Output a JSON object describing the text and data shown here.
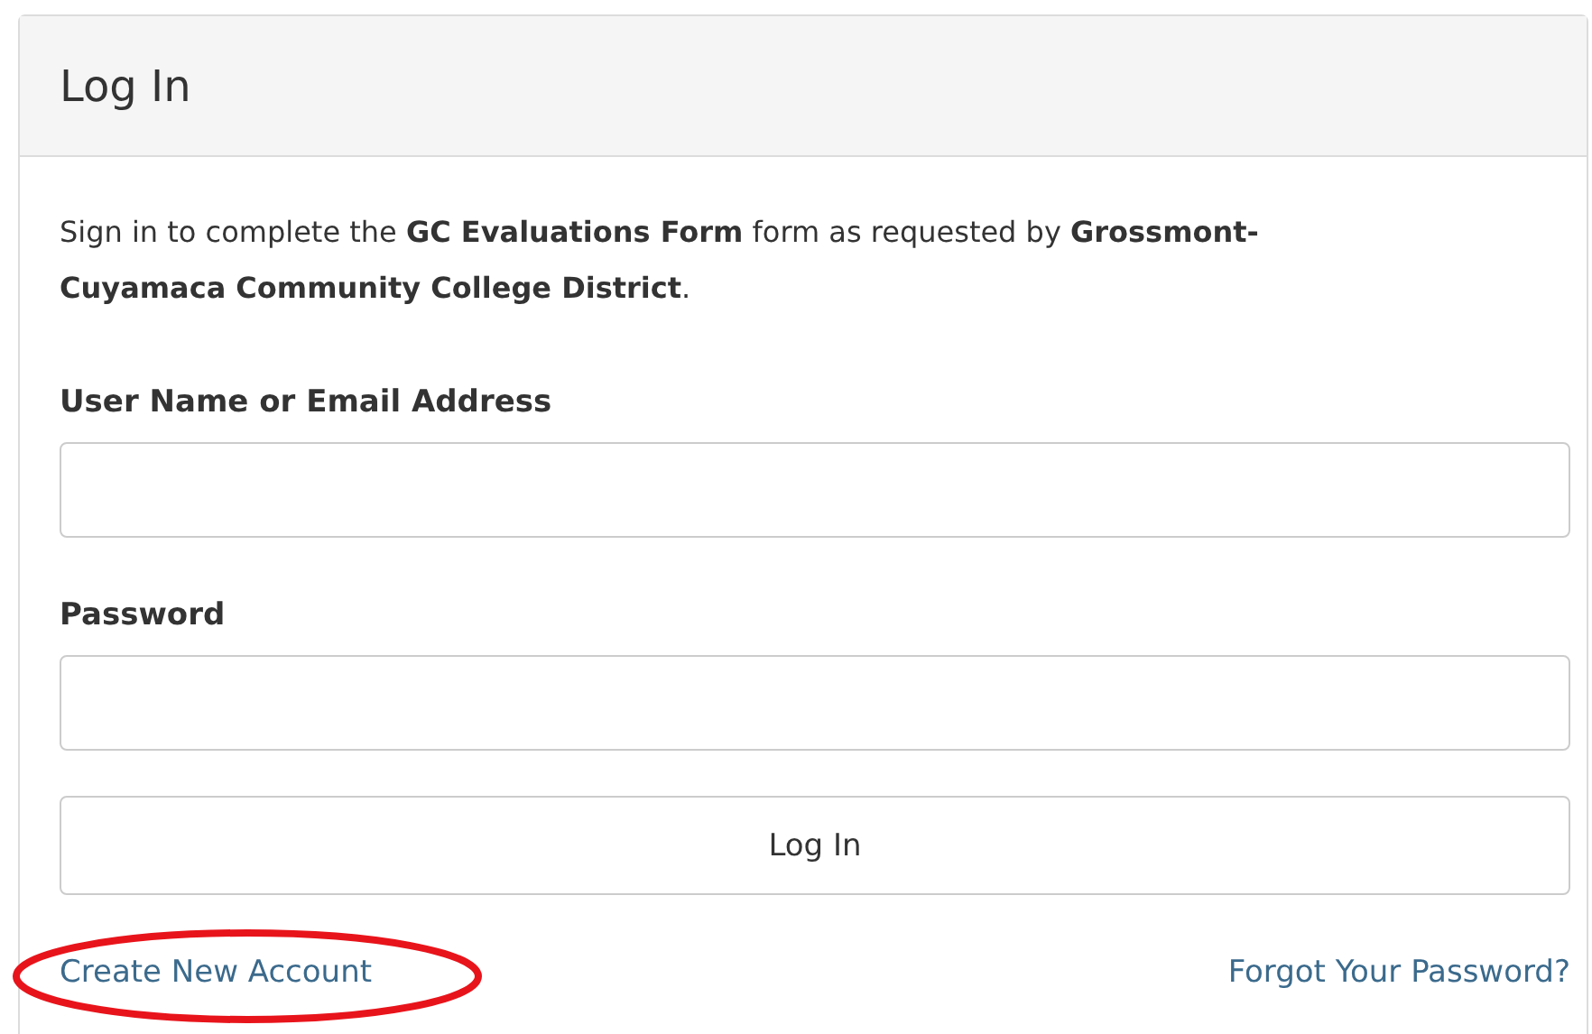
{
  "panel": {
    "title": "Log In"
  },
  "intro": "Sign in to complete the **GC Evaluations Form** form as requested by **Grossmont-Cuyamaca Community College District**.",
  "fields": [
    {
      "label": "User Name or Email Address"
    },
    {
      "label": "Password"
    }
  ],
  "submit": "Log In",
  "links": [
    {
      "text": "Create New Account",
      "circled": true
    },
    {
      "text": "Forgot Your Password?",
      "circled": false
    }
  ]
}
